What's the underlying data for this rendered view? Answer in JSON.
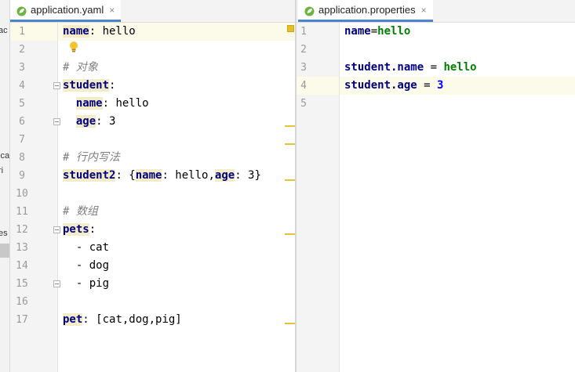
{
  "left_panel": {
    "fragments": [
      "ac",
      "ica",
      "ri",
      "es"
    ]
  },
  "left_editor": {
    "tab": {
      "title": "application.yaml",
      "close": "×",
      "icon": "spring-leaf-icon"
    },
    "line_numbers": [
      "1",
      "2",
      "3",
      "4",
      "5",
      "6",
      "7",
      "8",
      "9",
      "10",
      "11",
      "12",
      "13",
      "14",
      "15",
      "16",
      "17"
    ],
    "lines": {
      "l1_key": "name",
      "l1_sep": ": ",
      "l1_val": "hello",
      "l3": "# 对象",
      "l4_key": "student",
      "l4_sep": ":",
      "l5_key": "name",
      "l5_sep": ": ",
      "l5_val": "hello",
      "l6_key": "age",
      "l6_sep": ": ",
      "l6_val": "3",
      "l8": "# 行内写法",
      "l9_key": "student2",
      "l9_open": ": {",
      "l9_k1": "name",
      "l9_v1": ": hello,",
      "l9_k2": "age",
      "l9_v2": ": 3}",
      "l11": "# 数组",
      "l12_key": "pets",
      "l12_sep": ":",
      "l13": "  - cat",
      "l14": "  - dog",
      "l15": "  - pig",
      "l17_key": "pet",
      "l17_rest": ": [cat,dog,pig]"
    }
  },
  "right_editor": {
    "tab": {
      "title": "application.properties",
      "close": "×",
      "icon": "spring-leaf-icon"
    },
    "line_numbers": [
      "1",
      "2",
      "3",
      "4",
      "5"
    ],
    "lines": {
      "l1_key": "name",
      "l1_eq": "=",
      "l1_val": "hello",
      "l3_key": "student.name",
      "l3_eq": " = ",
      "l3_val": "hello",
      "l4_key": "student.age",
      "l4_eq": " = ",
      "l4_val": "3"
    }
  },
  "colors": {
    "key": "#000080",
    "comment": "#808080",
    "prop_value": "#008000",
    "number": "#0000ff",
    "current_line": "#fcfae8",
    "marker": "#e8c23a",
    "tab_underline": "#4b83cd"
  }
}
